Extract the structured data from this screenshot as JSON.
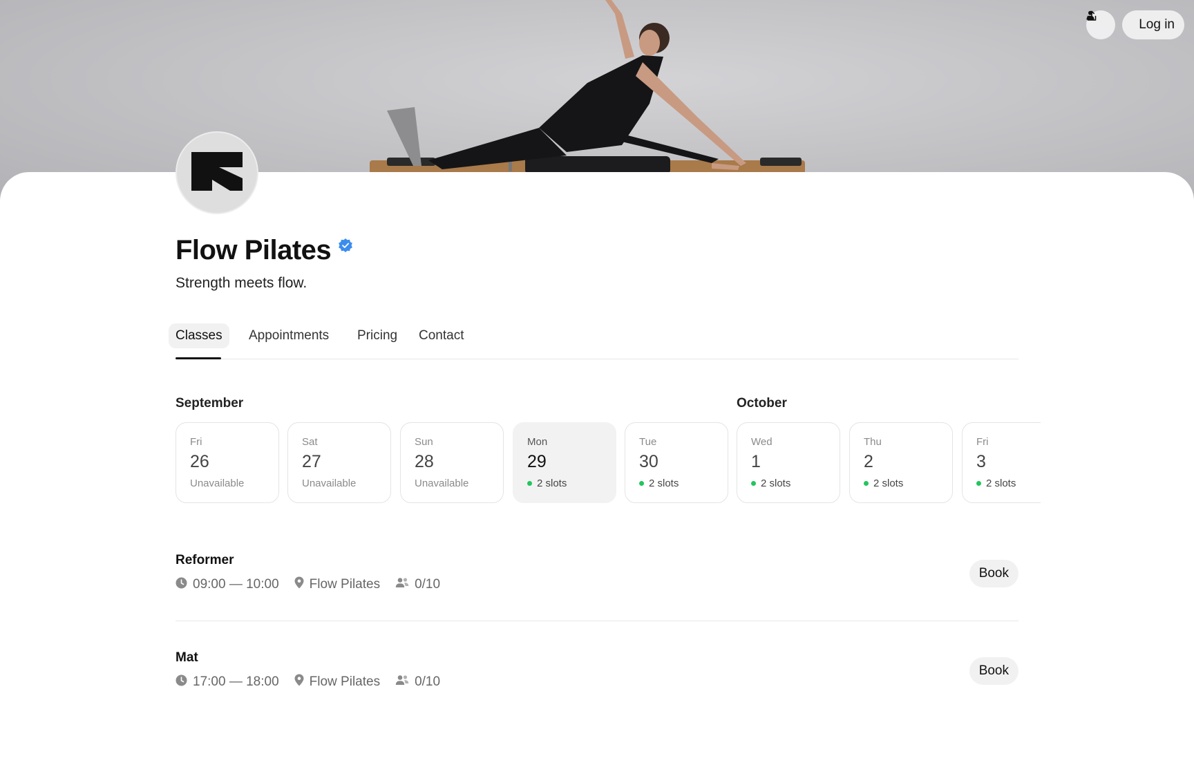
{
  "header": {
    "share_icon": "share-icon",
    "login_label": "Log in",
    "login_icon": "user-icon"
  },
  "profile": {
    "name": "Flow Pilates",
    "verified": true,
    "tagline": "Strength meets flow."
  },
  "tabs": [
    {
      "label": "Classes",
      "active": true
    },
    {
      "label": "Appointments",
      "active": false
    },
    {
      "label": "Pricing",
      "active": false
    },
    {
      "label": "Contact",
      "active": false
    }
  ],
  "calendar": {
    "months": [
      "September",
      "October"
    ],
    "days": [
      {
        "weekday": "Fri",
        "day": "26",
        "status": "Unavailable",
        "available": false,
        "selected": false
      },
      {
        "weekday": "Sat",
        "day": "27",
        "status": "Unavailable",
        "available": false,
        "selected": false
      },
      {
        "weekday": "Sun",
        "day": "28",
        "status": "Unavailable",
        "available": false,
        "selected": false
      },
      {
        "weekday": "Mon",
        "day": "29",
        "status": "2 slots",
        "available": true,
        "selected": true
      },
      {
        "weekday": "Tue",
        "day": "30",
        "status": "2 slots",
        "available": true,
        "selected": false
      },
      {
        "weekday": "Wed",
        "day": "1",
        "status": "2 slots",
        "available": true,
        "selected": false
      },
      {
        "weekday": "Thu",
        "day": "2",
        "status": "2 slots",
        "available": true,
        "selected": false
      },
      {
        "weekday": "Fri",
        "day": "3",
        "status": "2 slots",
        "available": true,
        "selected": false
      }
    ]
  },
  "classes": [
    {
      "title": "Reformer",
      "time": "09:00 — 10:00",
      "location": "Flow Pilates",
      "capacity": "0/10",
      "action": "Book"
    },
    {
      "title": "Mat",
      "time": "17:00 — 18:00",
      "location": "Flow Pilates",
      "capacity": "0/10",
      "action": "Book"
    }
  ],
  "colors": {
    "available_dot": "#22c55e",
    "verified_badge": "#3b8ded",
    "text_primary": "#111111",
    "text_muted": "#666666"
  }
}
